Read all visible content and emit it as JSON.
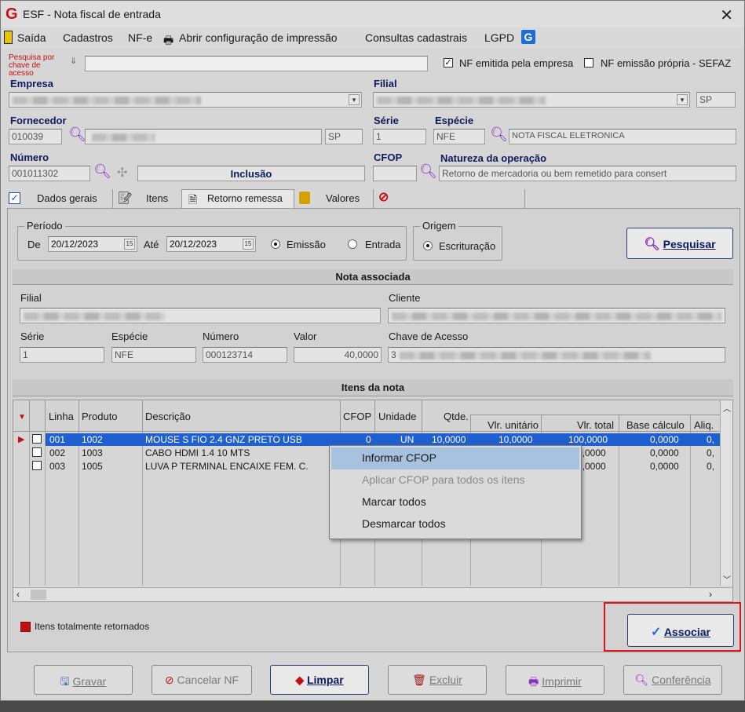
{
  "window": {
    "title": "ESF - Nota fiscal de entrada"
  },
  "menu": {
    "items": [
      "Saída",
      "Cadastros",
      "NF-e",
      "Abrir configuração de impressão",
      "Consultas cadastrais",
      "LGPD"
    ]
  },
  "search": {
    "label": "Pesquisa por chave de acesso",
    "value": ""
  },
  "options": {
    "nf_emitida": {
      "label": "NF emitida pela empresa",
      "checked": true
    },
    "nf_propria": {
      "label": "NF emissão própria - SEFAZ",
      "checked": false
    }
  },
  "header": {
    "empresa_label": "Empresa",
    "filial_label": "Filial",
    "filial_uf": "SP",
    "fornecedor_label": "Fornecedor",
    "fornecedor_code": "010039",
    "fornecedor_uf": "SP",
    "serie_label": "Série",
    "serie_value": "1",
    "especie_label": "Espécie",
    "especie_value": "NFE",
    "especie_desc": "NOTA FISCAL ELETRONICA",
    "numero_label": "Número",
    "numero_value": "001011302",
    "status": "Inclusão",
    "cfop_label": "CFOP",
    "natureza_label": "Natureza da operação",
    "natureza_value": "Retorno de mercadoria ou bem remetido para consert"
  },
  "tabs": [
    "Dados gerais",
    "Itens",
    "Retorno remessa",
    "Valores"
  ],
  "periodo": {
    "title": "Período",
    "de_label": "De",
    "de_value": "20/12/2023",
    "ate_label": "Até",
    "ate_value": "20/12/2023",
    "emissao": "Emissão",
    "entrada": "Entrada"
  },
  "origem": {
    "title": "Origem",
    "escrituracao": "Escrituração"
  },
  "pesquisar_label": "Pesquisar",
  "nota": {
    "title": "Nota associada",
    "filial_label": "Filial",
    "cliente_label": "Cliente",
    "serie_label": "Série",
    "serie_value": "1",
    "especie_label": "Espécie",
    "especie_value": "NFE",
    "numero_label": "Número",
    "numero_value": "000123714",
    "valor_label": "Valor",
    "valor_value": "40,0000",
    "chave_label": "Chave de Acesso",
    "chave_value": "3"
  },
  "itens": {
    "title": "Itens da nota",
    "columns": [
      "Linha",
      "Produto",
      "Descrição",
      "CFOP",
      "Unidade",
      "Qtde.",
      "Vlr. unitário",
      "Vlr. total",
      "Base cálculo",
      "Aliq."
    ],
    "rows": [
      {
        "linha": "001",
        "produto": "1002",
        "descricao": "MOUSE S FIO 2.4 GNZ PRETO USB",
        "cfop": "0",
        "unidade": "UN",
        "qtde": "10,0000",
        "unit": "10,0000",
        "total": "100,0000",
        "base": "0,0000",
        "aliq": "0,"
      },
      {
        "linha": "002",
        "produto": "1003",
        "descricao": "CABO HDMI 1.4 10 MTS",
        "cfop": "",
        "unidade": "",
        "qtde": "",
        "unit": "",
        "total": "0,0000",
        "base": "0,0000",
        "aliq": "0,"
      },
      {
        "linha": "003",
        "produto": "1005",
        "descricao": "LUVA P TERMINAL ENCAIXE FEM. C.",
        "cfop": "",
        "unidade": "",
        "qtde": "",
        "unit": "",
        "total": "0,0000",
        "base": "0,0000",
        "aliq": "0,"
      }
    ]
  },
  "context_menu": [
    "Informar CFOP",
    "Aplicar CFOP para todos os itens",
    "Marcar todos",
    "Desmarcar todos"
  ],
  "legend": "Itens totalmente retornados",
  "associar_label": "Associar",
  "buttons": {
    "gravar": "Gravar",
    "cancelar": "Cancelar NF",
    "limpar": "Limpar",
    "excluir": "Excluir",
    "imprimir": "Imprimir",
    "conferencia": "Conferência"
  },
  "colors": {
    "accent": "#0d1b5e",
    "danger": "#c21010",
    "selection": "#1f5fd0",
    "highlight": "#a6c2df"
  }
}
